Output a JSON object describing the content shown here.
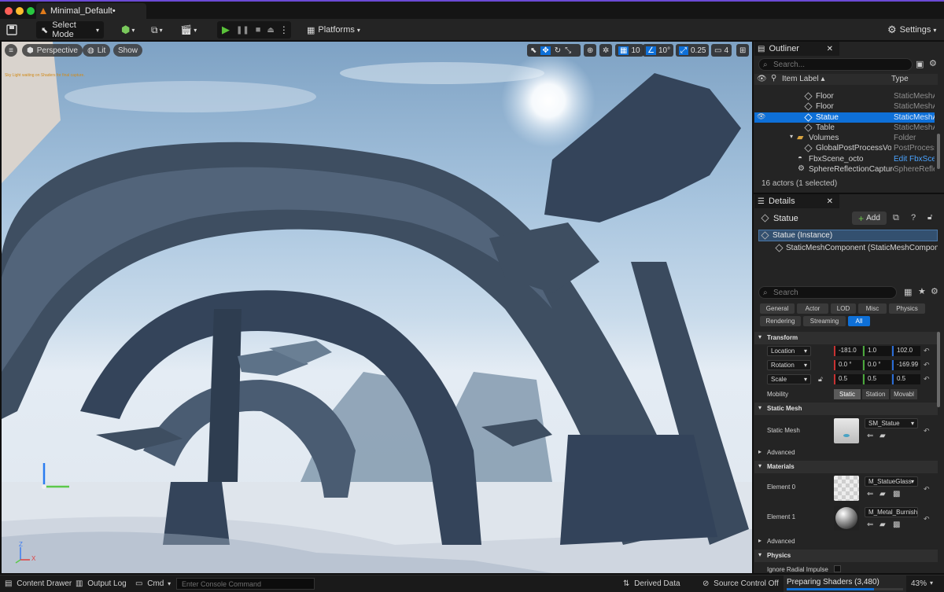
{
  "window": {
    "title": "Minimal_Default•"
  },
  "toolbar": {
    "select_mode": "Select Mode",
    "platforms": "Platforms",
    "settings": "Settings"
  },
  "viewport": {
    "perspective": "Perspective",
    "lit": "Lit",
    "show": "Show",
    "grid_snap": "10",
    "rot_snap": "10°",
    "scale_snap": "0.25",
    "camera_speed": "4",
    "message": "Sky Light waiting on Shaders for final capture.",
    "axis_z": "Z",
    "axis_x": "X"
  },
  "outliner": {
    "tab": "Outliner",
    "search_placeholder": "Search...",
    "col_label": "Item Label ▴",
    "col_type": "Type",
    "rows": [
      {
        "label": "Floor",
        "type": "StaticMeshA"
      },
      {
        "label": "Floor",
        "type": "StaticMeshA"
      },
      {
        "label": "Statue",
        "type": "StaticMeshA"
      },
      {
        "label": "Table",
        "type": "StaticMeshA"
      },
      {
        "label": "Volumes",
        "type": "Folder"
      },
      {
        "label": "GlobalPostProcessVolu",
        "type": "PostProcess"
      },
      {
        "label": "FbxScene_octo",
        "type": "Edit FbxScen"
      },
      {
        "label": "SphereReflectionCapture",
        "type": "SphereReflec"
      }
    ],
    "count": "16 actors (1 selected)"
  },
  "details": {
    "tab": "Details",
    "actor": "Statue",
    "add": "Add",
    "instance": "Statue (Instance)",
    "component": "StaticMeshComponent (StaticMeshComponentC",
    "search_placeholder": "Search",
    "categories": [
      "General",
      "Actor",
      "LOD",
      "Misc",
      "Physics",
      "Rendering",
      "Streaming",
      "All"
    ],
    "transform": {
      "title": "Transform",
      "location": {
        "label": "Location",
        "x": "-181.0",
        "y": "1.0",
        "z": "102.0"
      },
      "rotation": {
        "label": "Rotation",
        "x": "0.0 °",
        "y": "0.0 °",
        "z": "-169.99"
      },
      "scale": {
        "label": "Scale",
        "x": "0.5",
        "y": "0.5",
        "z": "0.5"
      },
      "mobility_label": "Mobility",
      "mobility": [
        "Static",
        "Station",
        "Movabl"
      ]
    },
    "static_mesh": {
      "title": "Static Mesh",
      "label": "Static Mesh",
      "value": "SM_Statue",
      "advanced": "Advanced"
    },
    "materials": {
      "title": "Materials",
      "element0_label": "Element 0",
      "element0": "M_StatueGlass",
      "element1_label": "Element 1",
      "element1": "M_Metal_Burnished_",
      "advanced": "Advanced"
    },
    "physics": {
      "title": "Physics",
      "first": "Ignore Radial Impulse"
    }
  },
  "statusbar": {
    "content_drawer": "Content Drawer",
    "output_log": "Output Log",
    "cmd": "Cmd",
    "console_placeholder": "Enter Console Command",
    "derived_data": "Derived Data",
    "source_control": "Source Control Off",
    "shaders": "Preparing Shaders (3,480)",
    "shader_progress": 0.75,
    "percent": "43%"
  }
}
